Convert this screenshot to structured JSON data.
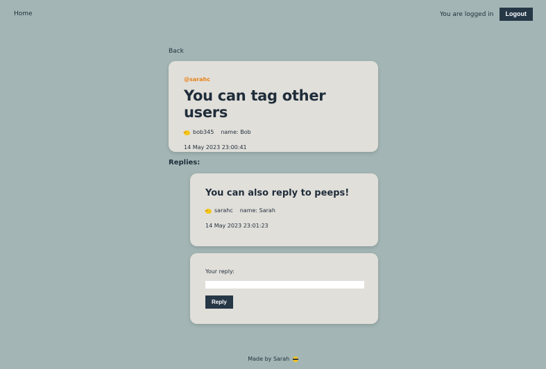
{
  "nav": {
    "home_label": "Home",
    "logged_in_text": "You are logged in",
    "logout_label": "Logout"
  },
  "back_label": "Back",
  "post": {
    "author_tag": "@sarahc",
    "title": "You can tag other users",
    "username": "bob345",
    "name": "name: Bob",
    "timestamp": "14 May 2023 23:00:41",
    "author_color": "#e8831a"
  },
  "replies_label": "Replies:",
  "replies": [
    {
      "title": "You can also reply to peeps!",
      "username": "sarahc",
      "name": "name: Sarah",
      "timestamp": "14 May 2023 23:01:23"
    }
  ],
  "reply_form": {
    "label": "Your reply:",
    "value": "",
    "button_label": "Reply"
  },
  "footer": {
    "text": "Made by Sarah",
    "icon": "face-with-sunglasses-icon"
  },
  "icons": {
    "user": "chick-icon"
  },
  "colors": {
    "background": "#a3b6b5",
    "card": "#e1dfda",
    "button": "#263746",
    "accent": "#e8831a"
  }
}
